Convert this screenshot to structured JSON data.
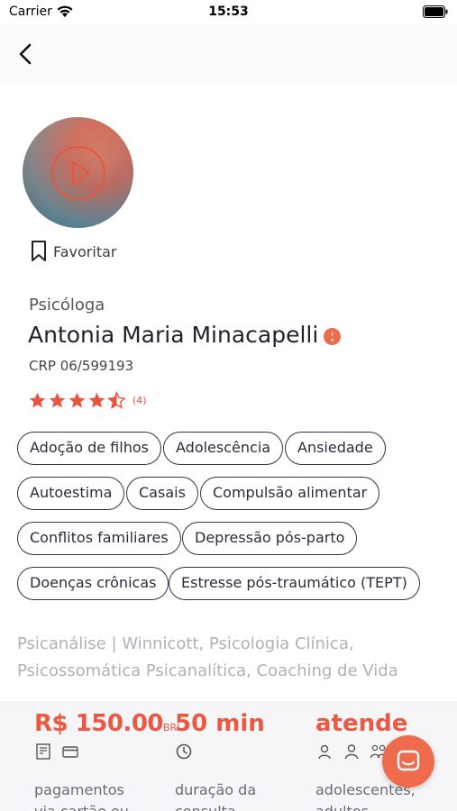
{
  "status_bar": {
    "carrier": "Carrier",
    "time": "15:53"
  },
  "profile": {
    "favorite_label": "Favoritar",
    "role": "Psicóloga",
    "name": "Antonia Maria Minacapelli",
    "crp": "CRP 06/599193",
    "rating": 4.5,
    "rating_count": "(4)",
    "tags": [
      "Adoção de filhos",
      "Adolescência",
      "Ansiedade",
      "Autoestima",
      "Casais",
      "Compulsão alimentar",
      "Conflitos familiares",
      "Depressão pós-parto",
      "Doenças crônicas",
      "Estresse pós-traumático (TEPT)"
    ],
    "approaches_line1": "Psicanálise | Winnicott, Psicologia Clínica,",
    "approaches_line2": "Psicossomática Psicanalítica, Coaching de Vida"
  },
  "summary": {
    "price": "R$ 150.00",
    "currency": "BRL",
    "duration": "50 min",
    "attends": "atende",
    "payments_line1": "pagamentos",
    "payments_line2": "via cartão ou",
    "duration_line1": "duração da",
    "duration_line2": "consulta",
    "attends_line1": "adolescentes,",
    "attends_line2": "adultos"
  },
  "icons": {
    "back": "chevron-left-icon",
    "favorite": "bookmark-icon",
    "verified": "verified-badge-icon",
    "star": "star-icon",
    "chat": "chat-icon"
  },
  "colors": {
    "accent": "#ea5a43",
    "tag_border": "#31324a",
    "muted": "#b0b0b8"
  }
}
